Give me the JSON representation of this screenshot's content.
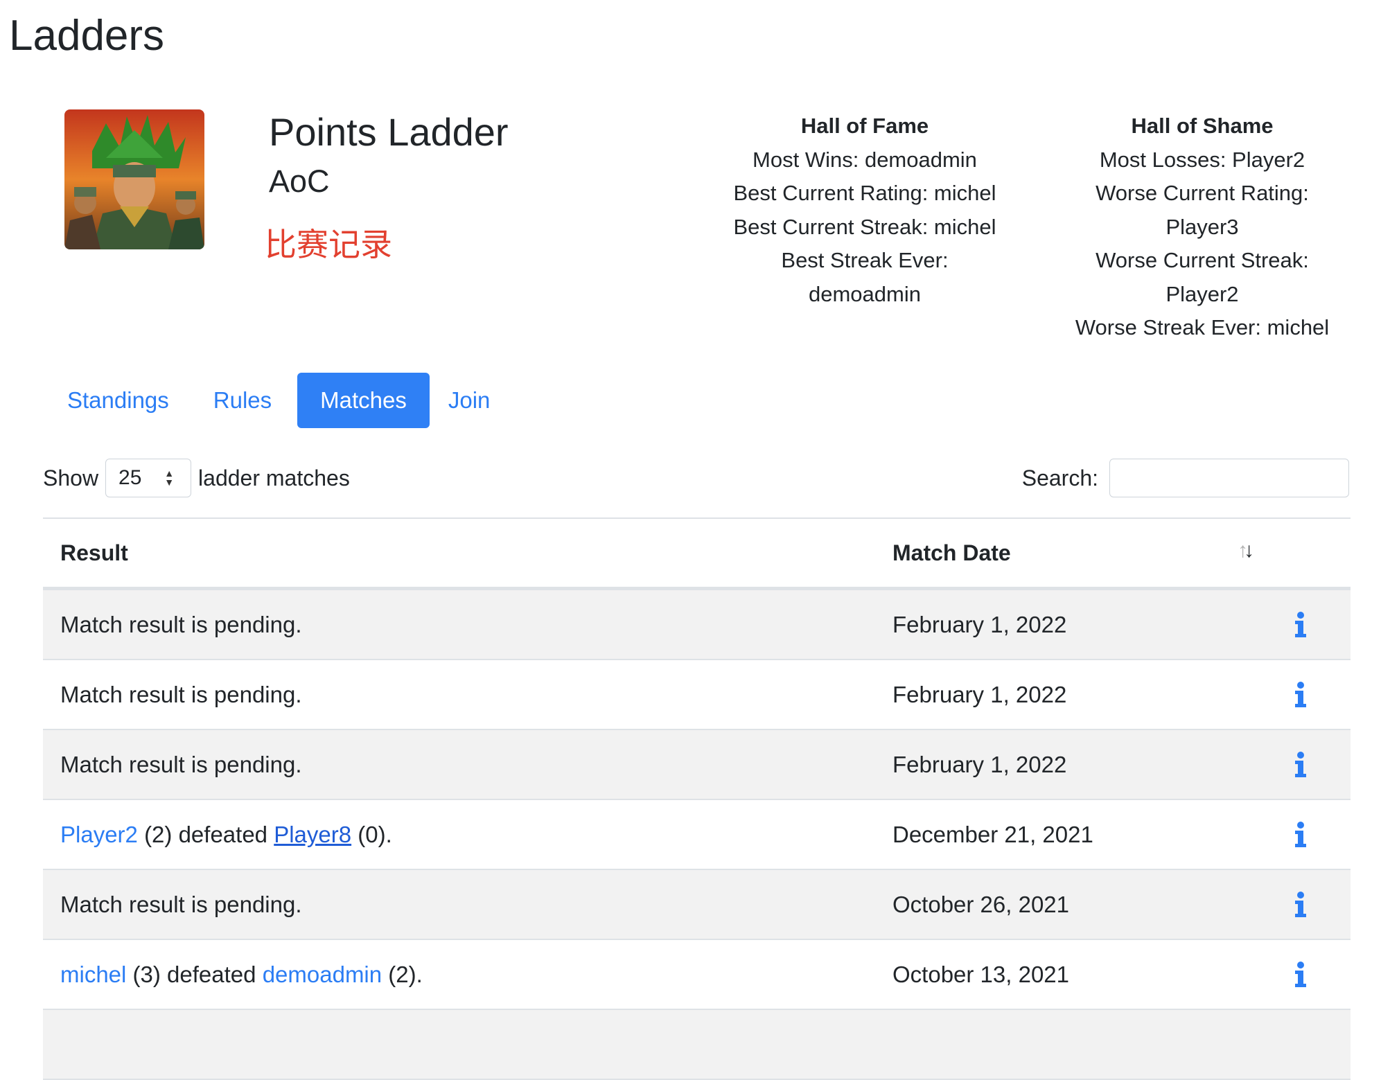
{
  "page": {
    "title": "Ladders"
  },
  "ladder": {
    "name": "Points Ladder",
    "game": "AoC",
    "subtitle": "比赛记录",
    "image_icon": "ladder-avatar-image"
  },
  "hall_of_fame": {
    "title": "Hall of Fame",
    "lines": [
      "Most Wins: demoadmin",
      "Best Current Rating: michel",
      "Best Current Streak: michel",
      "Best Streak Ever:",
      "demoadmin"
    ]
  },
  "hall_of_shame": {
    "title": "Hall of Shame",
    "lines": [
      "Most Losses: Player2",
      "Worse Current Rating:",
      "Player3",
      "Worse Current Streak:",
      "Player2",
      "Worse Streak Ever: michel"
    ]
  },
  "tabs": [
    {
      "label": "Standings",
      "active": false
    },
    {
      "label": "Rules",
      "active": false
    },
    {
      "label": "Matches",
      "active": true
    },
    {
      "label": "Join",
      "active": false
    }
  ],
  "controls": {
    "show_label": "Show",
    "page_length": "25",
    "suffix_label": "ladder matches",
    "search_label": "Search:",
    "search_value": ""
  },
  "table": {
    "headers": {
      "result": "Result",
      "match_date": "Match Date"
    },
    "sort_icon": "sort-arrows-icon",
    "info_icon": "info-icon",
    "rows": [
      {
        "result": "Match result is pending.",
        "date": "February 1, 2022"
      },
      {
        "result": "Match result is pending.",
        "date": "February 1, 2022"
      },
      {
        "result": "Match result is pending.",
        "date": "February 1, 2022"
      },
      {
        "winner": "Player2",
        "winner_score": "(2)",
        "verb": "defeated",
        "loser": "Player8",
        "loser_score": "(0).",
        "date": "December 21, 2021"
      },
      {
        "result": "Match result is pending.",
        "date": "October 26, 2021"
      },
      {
        "winner": "michel",
        "winner_score": "(3)",
        "verb": "defeated",
        "loser": "demoadmin",
        "loser_score": "(2).",
        "date": "October 13, 2021"
      }
    ]
  },
  "colors": {
    "accent": "#2f80f5",
    "link": "#2b7df4",
    "subtitle_red": "#e2402f",
    "row_stripe": "#f2f2f2"
  }
}
